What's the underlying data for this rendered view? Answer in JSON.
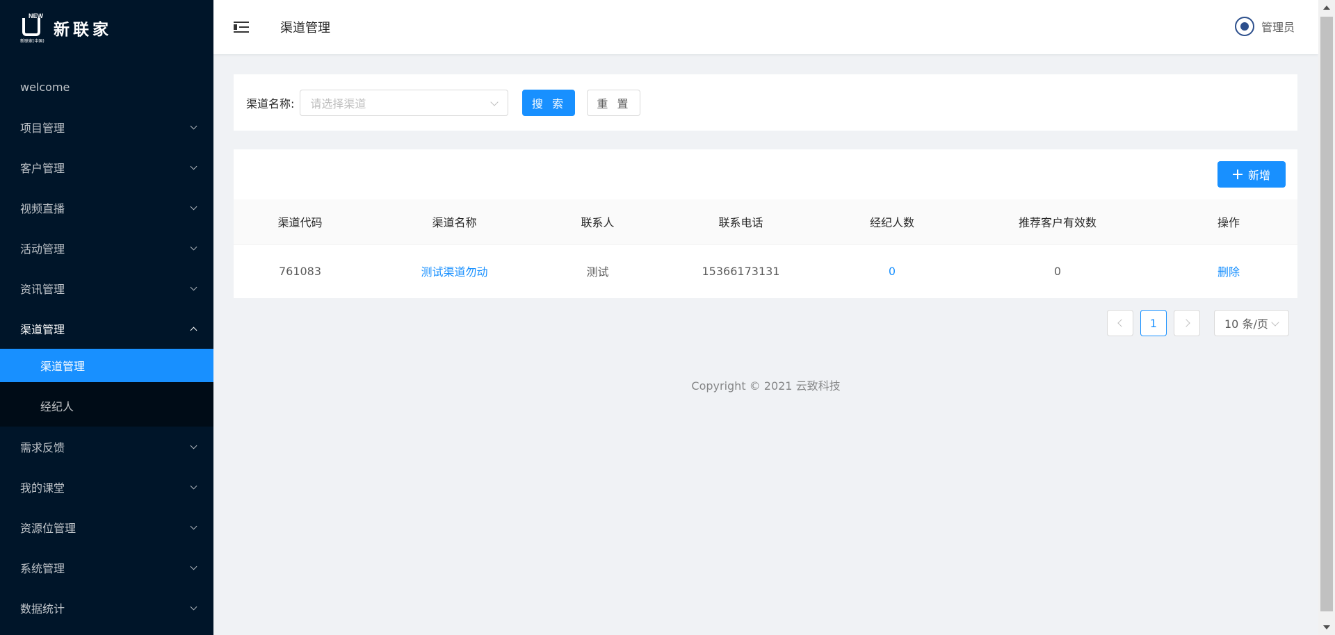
{
  "brand": {
    "logo_new": "NEW",
    "logo_sub": "新联家(中国)",
    "name": "新联家"
  },
  "sidebar": {
    "items": [
      {
        "label": "welcome"
      },
      {
        "label": "项目管理"
      },
      {
        "label": "客户管理"
      },
      {
        "label": "视频直播"
      },
      {
        "label": "活动管理"
      },
      {
        "label": "资讯管理"
      },
      {
        "label": "渠道管理",
        "open": true
      },
      {
        "label": "需求反馈"
      },
      {
        "label": "我的课堂"
      },
      {
        "label": "资源位管理"
      },
      {
        "label": "系统管理"
      },
      {
        "label": "数据统计"
      }
    ],
    "submenu": [
      {
        "label": "渠道管理",
        "active": true
      },
      {
        "label": "经纪人"
      }
    ]
  },
  "header": {
    "title": "渠道管理",
    "user_name": "管理员"
  },
  "search": {
    "label": "渠道名称:",
    "placeholder": "请选择渠道",
    "search_button": "搜 索",
    "reset_button": "重 置"
  },
  "table": {
    "add_button": "新增",
    "columns": [
      "渠道代码",
      "渠道名称",
      "联系人",
      "联系电话",
      "经纪人数",
      "推荐客户有效数",
      "操作"
    ],
    "rows": [
      {
        "code": "761083",
        "name": "测试渠道勿动",
        "contact": "测试",
        "phone": "15366173131",
        "agents": "0",
        "valid_referrals": "0",
        "action": "删除"
      }
    ]
  },
  "pagination": {
    "current_page": "1",
    "page_size": "10 条/页"
  },
  "footer": {
    "copyright": "Copyright © 2021 云致科技"
  },
  "colors": {
    "sidebar_bg": "#001529",
    "primary": "#1890ff",
    "page_bg": "#f0f2f5"
  }
}
